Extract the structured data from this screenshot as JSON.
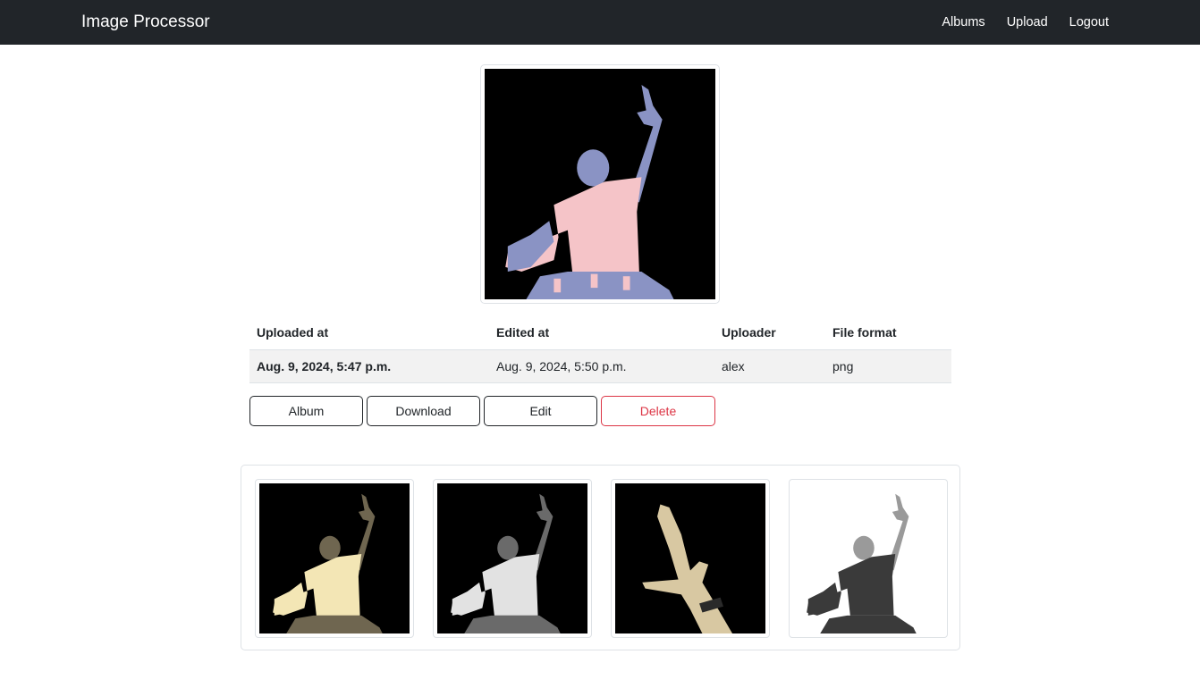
{
  "navbar": {
    "brand": "Image Processor",
    "links": [
      "Albums",
      "Upload",
      "Logout"
    ]
  },
  "main_image": {
    "icon": "person-silhouette-image",
    "colors": {
      "background": "#000000",
      "figure": "#f5c4c8",
      "shadow": "#8a93c4"
    }
  },
  "info_table": {
    "headers": [
      "Uploaded at",
      "Edited at",
      "Uploader",
      "File format"
    ],
    "row": {
      "uploaded_at": "Aug. 9, 2024, 5:47 p.m.",
      "edited_at": "Aug. 9, 2024, 5:50 p.m.",
      "uploader": "alex",
      "file_format": "png"
    }
  },
  "actions": {
    "album": "Album",
    "download": "Download",
    "edit": "Edit",
    "delete": "Delete"
  },
  "variants": [
    {
      "name": "sepia",
      "background": "#000000",
      "figure": "#f3e6b5",
      "shadow": "#6f6650"
    },
    {
      "name": "grayscale",
      "background": "#000000",
      "figure": "#e2e2e2",
      "shadow": "#6a6a6a"
    },
    {
      "name": "hand-closeup",
      "background": "#000000",
      "figure": "#d8c8a2",
      "shadow": "#7d6e55"
    },
    {
      "name": "inverted",
      "background": "#ffffff",
      "figure": "#3a3a3a",
      "shadow": "#9a9a9a"
    }
  ],
  "colors": {
    "navbar": "#212529",
    "border": "#dee2e6",
    "danger": "#dc3545",
    "table_stripe": "#f2f2f2"
  }
}
